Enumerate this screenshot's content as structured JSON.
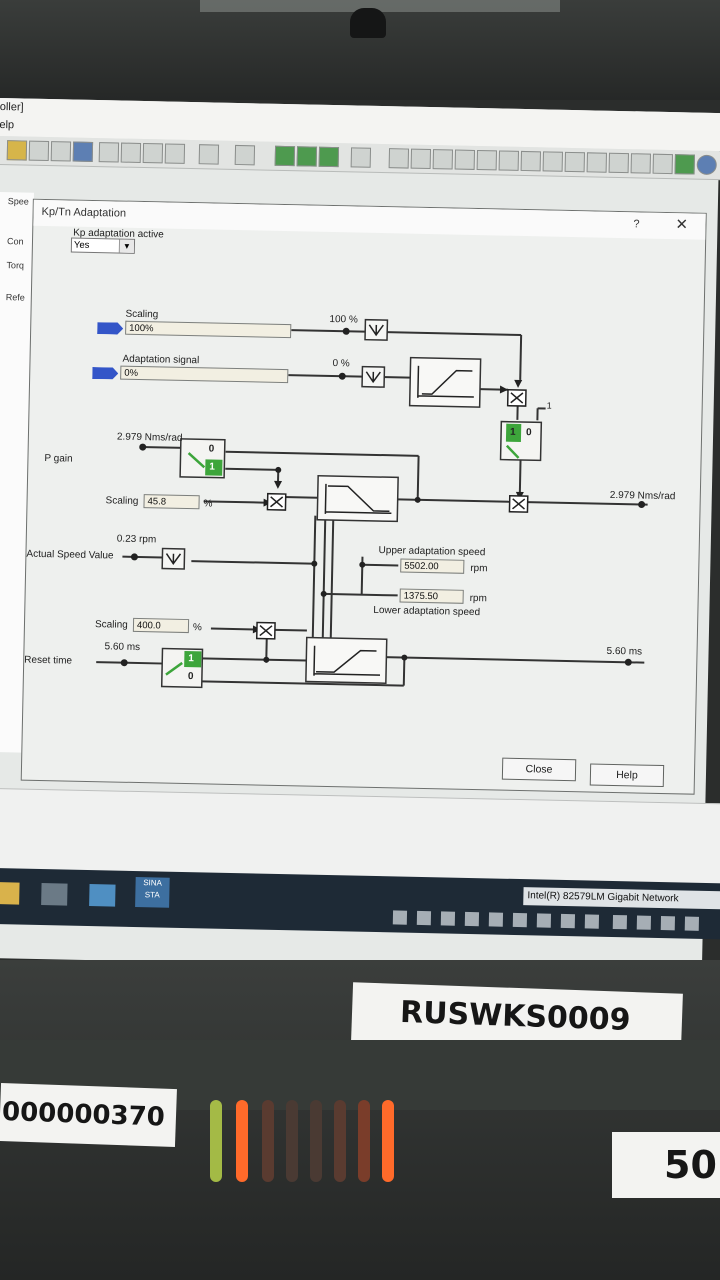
{
  "window": {
    "title_fragment": "oller]",
    "menu_fragment": "elp"
  },
  "left_pane": [
    "Spee",
    "Con",
    "Torq",
    "Refe"
  ],
  "dialog": {
    "title": "Kp/Tn Adaptation",
    "help": "?",
    "close": "✕",
    "kp_adaptation_label": "Kp adaptation active",
    "kp_adaptation_value": "Yes",
    "scaling_label": "Scaling",
    "scaling_value": "100%",
    "scaling_tap": "100 %",
    "adaptation_signal_label": "Adaptation signal",
    "adaptation_signal_value": "0%",
    "adaptation_signal_tap": "0 %",
    "select_one": "1",
    "switch_top_1": "1",
    "switch_top_0": "0",
    "p_gain_label": "P gain",
    "p_gain_value": "2.979 Nms/rad",
    "switch_p_0": "0",
    "switch_p_1": "1",
    "p_scaling_label": "Scaling",
    "p_scaling_value": "45.8",
    "p_scaling_unit": "%",
    "p_gain_output": "2.979 Nms/rad",
    "actual_speed_label": "Actual Speed Value",
    "actual_speed_value": "0.23 rpm",
    "upper_adapt_label": "Upper adaptation speed",
    "upper_adapt_value": "5502.00",
    "upper_adapt_unit": "rpm",
    "lower_adapt_value": "1375.50",
    "lower_adapt_unit": "rpm",
    "lower_adapt_label": "Lower adaptation speed",
    "tn_scaling_label": "Scaling",
    "tn_scaling_value": "400.0",
    "tn_scaling_unit": "%",
    "reset_time_label": "Reset time",
    "reset_time_value": "5.60 ms",
    "switch_r_1": "1",
    "switch_r_0": "0",
    "reset_time_output": "5.60 ms",
    "btn_close": "Close",
    "btn_help": "Help"
  },
  "taskbar": {
    "app_label": "SINA STA",
    "network": "Intel(R) 82579LM Gigabit Network"
  },
  "hardware": {
    "asset_tag": "RUSWKS0009",
    "serial_fragment": "000000370",
    "right_fragment": "50"
  },
  "colors": {
    "screen_bg": "#eef0ee",
    "diagram_line": "#333333",
    "switch_green": "#3da53b",
    "connector_blue": "#3355c8",
    "taskbar": "#1e2a36",
    "led_green": "#b8d24a",
    "led_orange": "#ff6a2a"
  }
}
